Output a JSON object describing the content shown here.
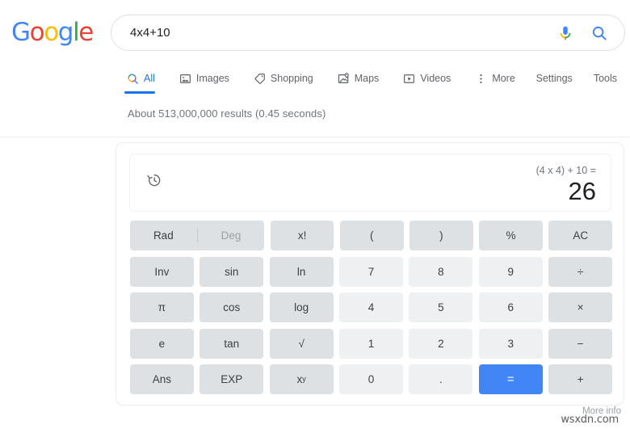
{
  "brand": {
    "name": "Google",
    "letters": [
      {
        "ch": "G",
        "color": "#4285F4"
      },
      {
        "ch": "o",
        "color": "#EA4335"
      },
      {
        "ch": "o",
        "color": "#FBBC05"
      },
      {
        "ch": "g",
        "color": "#4285F4"
      },
      {
        "ch": "l",
        "color": "#34A853"
      },
      {
        "ch": "e",
        "color": "#EA4335"
      }
    ]
  },
  "search": {
    "value": "4x4+10",
    "placeholder": "Search",
    "mic_icon": "microphone-icon",
    "search_icon": "search-icon"
  },
  "nav": {
    "tabs": [
      {
        "label": "All",
        "icon": "search-icon",
        "active": true
      },
      {
        "label": "Images",
        "icon": "image-icon",
        "active": false
      },
      {
        "label": "Shopping",
        "icon": "tag-icon",
        "active": false
      },
      {
        "label": "Maps",
        "icon": "map-pin-icon",
        "active": false
      },
      {
        "label": "Videos",
        "icon": "video-play-icon",
        "active": false
      },
      {
        "label": "More",
        "icon": "more-vertical-icon",
        "active": false
      }
    ],
    "settings": "Settings",
    "tools": "Tools"
  },
  "results": {
    "stats": "About 513,000,000 results (0.45 seconds)"
  },
  "calculator": {
    "history_icon": "history-clock-icon",
    "expression": "(4 x 4) + 10 =",
    "answer": "26",
    "mode": {
      "rad": "Rad",
      "deg": "Deg",
      "active": "Rad"
    },
    "rows": [
      [
        {
          "label": "x!",
          "type": "fn"
        },
        {
          "label": "(",
          "type": "fn"
        },
        {
          "label": ")",
          "type": "fn"
        },
        {
          "label": "%",
          "type": "fn"
        },
        {
          "label": "AC",
          "type": "fn"
        }
      ],
      [
        {
          "label": "Inv",
          "type": "fn"
        },
        {
          "label": "sin",
          "type": "fn"
        },
        {
          "label": "ln",
          "type": "fn"
        },
        {
          "label": "7",
          "type": "num"
        },
        {
          "label": "8",
          "type": "num"
        },
        {
          "label": "9",
          "type": "num"
        },
        {
          "label": "÷",
          "type": "fn"
        }
      ],
      [
        {
          "label": "π",
          "type": "fn"
        },
        {
          "label": "cos",
          "type": "fn"
        },
        {
          "label": "log",
          "type": "fn"
        },
        {
          "label": "4",
          "type": "num"
        },
        {
          "label": "5",
          "type": "num"
        },
        {
          "label": "6",
          "type": "num"
        },
        {
          "label": "×",
          "type": "fn"
        }
      ],
      [
        {
          "label": "e",
          "type": "fn"
        },
        {
          "label": "tan",
          "type": "fn"
        },
        {
          "label": "√",
          "type": "fn"
        },
        {
          "label": "1",
          "type": "num"
        },
        {
          "label": "2",
          "type": "num"
        },
        {
          "label": "3",
          "type": "num"
        },
        {
          "label": "−",
          "type": "fn"
        }
      ],
      [
        {
          "label": "Ans",
          "type": "fn"
        },
        {
          "label": "EXP",
          "type": "fn"
        },
        {
          "label": "x",
          "sup": "y",
          "type": "fn"
        },
        {
          "label": "0",
          "type": "num"
        },
        {
          "label": ".",
          "type": "num"
        },
        {
          "label": "=",
          "type": "eq"
        },
        {
          "label": "+",
          "type": "fn"
        }
      ]
    ]
  },
  "footer": {
    "more_info": "More info",
    "watermark": "wsxdn.com"
  },
  "colors": {
    "accent_blue": "#4285f4",
    "link_blue": "#1a73e8",
    "fn_key": "#dee1e3",
    "num_key": "#eef0f2",
    "muted_text": "#70757a"
  }
}
